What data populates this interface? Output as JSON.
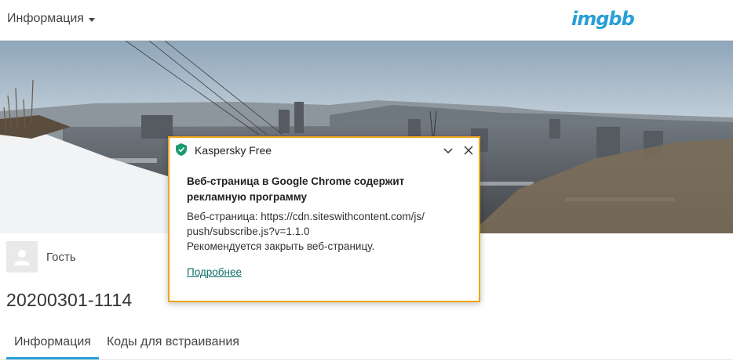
{
  "header": {
    "menu_label": "Информация",
    "logo_text": "imgbb",
    "logo_color": "#2a9fd6"
  },
  "banner": {
    "description_icon": "landscape-photo"
  },
  "user": {
    "name": "Гость"
  },
  "image": {
    "title": "20200301-1114"
  },
  "tabs": [
    {
      "label": "Информация",
      "active": true
    },
    {
      "label": "Коды для встраивания",
      "active": false
    }
  ],
  "popup": {
    "app_name": "Kaspersky Free",
    "heading": "Веб-страница в Google Chrome содержит рекламную программу",
    "body_line1": "Веб-страница: https://cdn.siteswithcontent.com/js/",
    "body_line2": "push/subscribe.js?v=1.1.0",
    "body_line3": "Рекомендуется закрыть веб-страницу.",
    "link_label": "Подробнее",
    "border_color": "#f0a41c",
    "shield_color": "#1a9b72"
  }
}
